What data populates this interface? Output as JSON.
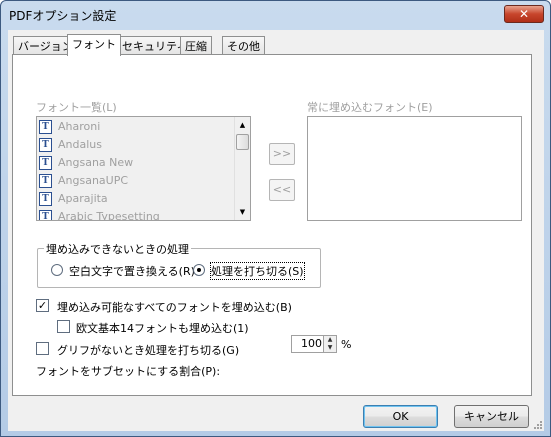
{
  "window": {
    "title": "PDFオプション設定",
    "close_symbol": "✕"
  },
  "tabs": [
    {
      "label": "バージョン"
    },
    {
      "label": "フォント"
    },
    {
      "label": "セキュリティ"
    },
    {
      "label": "圧縮"
    },
    {
      "label": "その他"
    }
  ],
  "font_list": {
    "label": "フォント一覧(L)",
    "items": [
      "Aharoni",
      "Andalus",
      "Angsana New",
      "AngsanaUPC",
      "Aparajita",
      "Arabic Typesetting"
    ],
    "icon": "truetype-font-icon"
  },
  "embed_list": {
    "label": "常に埋め込むフォント(E)",
    "items": []
  },
  "move_buttons": {
    "add_label": ">>",
    "remove_label": "<<"
  },
  "fallback_group": {
    "title": "埋め込みできないときの処理",
    "option_replace": "空白文字で置き換える(R)",
    "option_abort": "処理を打ち切る(S)",
    "selected": "option_abort"
  },
  "options": {
    "embed_all_label": "埋め込み可能なすべてのフォントを埋め込む(B)",
    "embed_all_checked": true,
    "embed_base14_label": "欧文基本14フォントも埋め込む(1)",
    "embed_base14_checked": false,
    "abort_missing_glyph_label": "グリフがないとき処理を打ち切る(G)",
    "abort_missing_glyph_checked": false,
    "check_mark": "✓"
  },
  "subset": {
    "label": "フォントをサブセットにする割合(P):",
    "value": "100",
    "unit": "%",
    "up": "▲",
    "down": "▼"
  },
  "buttons": {
    "ok_label": "OK",
    "cancel_label": "キャンセル"
  },
  "scroll": {
    "up": "▲",
    "down": "▼"
  },
  "colors": {
    "title_gradient_top": "#c9dbee",
    "close_red": "#c7452c",
    "disabled_text": "#a0a0a0",
    "focus_blue": "#3c7fb1"
  }
}
